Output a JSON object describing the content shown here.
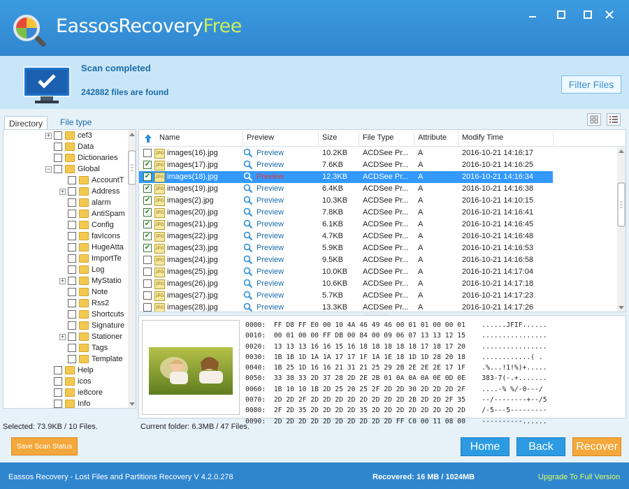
{
  "window": {
    "title_main": "EassosRecovery",
    "title_free": "Free",
    "minimize_icon": "minimize-icon",
    "maximize_icon": "maximize-icon",
    "close_icon": "close-icon"
  },
  "status": {
    "title": "Scan completed",
    "count": "242882 files are found",
    "filter_button": "Filter Files"
  },
  "tabs": [
    "Directory",
    "File type"
  ],
  "tree": [
    {
      "label": "cef3",
      "indent": 1,
      "exp": "+",
      "checked": false
    },
    {
      "label": "Data",
      "indent": 1,
      "exp": "",
      "checked": false
    },
    {
      "label": "Dictionaries",
      "indent": 1,
      "exp": "",
      "checked": false
    },
    {
      "label": "Global",
      "indent": 1,
      "exp": "−",
      "checked": false
    },
    {
      "label": "AccountT",
      "indent": 2,
      "exp": "",
      "checked": false
    },
    {
      "label": "Address",
      "indent": 2,
      "exp": "+",
      "checked": false
    },
    {
      "label": "alarm",
      "indent": 2,
      "exp": "",
      "checked": false
    },
    {
      "label": "AntiSpam",
      "indent": 2,
      "exp": "",
      "checked": false
    },
    {
      "label": "Config",
      "indent": 2,
      "exp": "",
      "checked": false
    },
    {
      "label": "favIcons",
      "indent": 2,
      "exp": "",
      "checked": false
    },
    {
      "label": "HugeAtta",
      "indent": 2,
      "exp": "",
      "checked": false
    },
    {
      "label": "ImportTe",
      "indent": 2,
      "exp": "",
      "checked": false
    },
    {
      "label": "Log",
      "indent": 2,
      "exp": "",
      "checked": false
    },
    {
      "label": "MyStatio",
      "indent": 2,
      "exp": "+",
      "checked": false
    },
    {
      "label": "Note",
      "indent": 2,
      "exp": "",
      "checked": false
    },
    {
      "label": "Rss2",
      "indent": 2,
      "exp": "",
      "checked": false
    },
    {
      "label": "Shortcuts",
      "indent": 2,
      "exp": "",
      "checked": false
    },
    {
      "label": "Signature",
      "indent": 2,
      "exp": "",
      "checked": false
    },
    {
      "label": "Stationer",
      "indent": 2,
      "exp": "+",
      "checked": false
    },
    {
      "label": "Tags",
      "indent": 2,
      "exp": "",
      "checked": false
    },
    {
      "label": "Template",
      "indent": 2,
      "exp": "",
      "checked": false
    },
    {
      "label": "Help",
      "indent": 1,
      "exp": "",
      "checked": false
    },
    {
      "label": "icos",
      "indent": 1,
      "exp": "",
      "checked": false
    },
    {
      "label": "ie8core",
      "indent": 1,
      "exp": "",
      "checked": false
    },
    {
      "label": "Info",
      "indent": 1,
      "exp": "",
      "checked": false
    }
  ],
  "columns": [
    "Name",
    "Preview",
    "Size",
    "File Type",
    "Attribute",
    "Modify Time"
  ],
  "files": [
    {
      "name": "images(16).jpg",
      "preview": "Preview",
      "size": "10.2KB",
      "type": "ACDSee Pr...",
      "attr": "A",
      "time": "2016-10-21 14:16:17",
      "checked": false
    },
    {
      "name": "images(17).jpg",
      "preview": "Preview",
      "size": "7.6KB",
      "type": "ACDSee Pr...",
      "attr": "A",
      "time": "2016-10-21 14:16:25",
      "checked": true
    },
    {
      "name": "images(18).jpg",
      "preview": "Preview",
      "size": "12.3KB",
      "type": "ACDSee Pr...",
      "attr": "A",
      "time": "2016-10-21 14:16:34",
      "checked": true,
      "selected": true
    },
    {
      "name": "images(19).jpg",
      "preview": "Preview",
      "size": "6.4KB",
      "type": "ACDSee Pr...",
      "attr": "A",
      "time": "2016-10-21 14:16:38",
      "checked": true
    },
    {
      "name": "images(2).jpg",
      "preview": "Preview",
      "size": "10.3KB",
      "type": "ACDSee Pr...",
      "attr": "A",
      "time": "2016-10-21 14:10:15",
      "checked": true
    },
    {
      "name": "images(20).jpg",
      "preview": "Preview",
      "size": "7.8KB",
      "type": "ACDSee Pr...",
      "attr": "A",
      "time": "2016-10-21 14:16:41",
      "checked": true
    },
    {
      "name": "images(21).jpg",
      "preview": "Preview",
      "size": "6.1KB",
      "type": "ACDSee Pr...",
      "attr": "A",
      "time": "2016-10-21 14:16:45",
      "checked": true
    },
    {
      "name": "images(22).jpg",
      "preview": "Preview",
      "size": "4.7KB",
      "type": "ACDSee Pr...",
      "attr": "A",
      "time": "2016-10-21 14:16:48",
      "checked": true
    },
    {
      "name": "images(23).jpg",
      "preview": "Preview",
      "size": "5.9KB",
      "type": "ACDSee Pr...",
      "attr": "A",
      "time": "2016-10-21 14:16:53",
      "checked": true
    },
    {
      "name": "images(24).jpg",
      "preview": "Preview",
      "size": "9.5KB",
      "type": "ACDSee Pr...",
      "attr": "A",
      "time": "2016-10-21 14:16:58",
      "checked": false
    },
    {
      "name": "images(25).jpg",
      "preview": "Preview",
      "size": "10.0KB",
      "type": "ACDSee Pr...",
      "attr": "A",
      "time": "2016-10-21 14:17:04",
      "checked": false
    },
    {
      "name": "images(26).jpg",
      "preview": "Preview",
      "size": "10.6KB",
      "type": "ACDSee Pr...",
      "attr": "A",
      "time": "2016-10-21 14:17:18",
      "checked": false
    },
    {
      "name": "images(27).jpg",
      "preview": "Preview",
      "size": "5.7KB",
      "type": "ACDSee Pr...",
      "attr": "A",
      "time": "2016-10-21 14:17:23",
      "checked": false
    },
    {
      "name": "images(28).jpg",
      "preview": "Preview",
      "size": "13.3KB",
      "type": "ACDSee Pr...",
      "attr": "A",
      "time": "2016-10-21 14:17:26",
      "checked": false
    }
  ],
  "hex_lines": [
    "0000:  FF D8 FF E0 00 10 4A 46 49 46 00 01 01 00 00 01    ......JFIF......",
    "0010:  00 01 00 00 FF DB 00 84 00 09 06 07 13 13 12 15    ................",
    "0020:  13 13 13 16 16 15 16 18 18 18 18 18 17 18 17 20    ................",
    "0030:  1B 1B 1D 1A 1A 17 17 1F 1A 1E 18 1D 1D 28 20 18    ............( .",
    "0040:  1B 25 1D 16 16 21 31 21 25 29 2B 2E 2E 2E 17 1F    .%...!1!%)+.....",
    "0050:  33 38 33 2D 37 28 2D 2E 2B 01 0A 0A 0A 0E 0D 0E    383-7(-.+.......",
    "0060:  1B 10 10 1B 2D 25 20 25 2F 2D 2D 30 2D 2D 2D 2F    ....-% %/-0---/",
    "0070:  2D 2D 2F 2D 2D 2D 2D 2D 2D 2D 2D 2B 2D 2D 2F 35    --/--------+--/5",
    "0080:  2F 2D 35 2D 2D 2D 2D 35 2D 2D 2D 2D 2D 2D 2D 2D    /-5---5---------",
    "0090:  2D 2D 2D 2D 2D 2D 2D 2D 2D 2D FF C0 00 11 08 00    ----------......"
  ],
  "selected_info": "Selected: 73.9KB / 10 Files.",
  "folder_info": "Current folder: 6.3MB / 47 Files.",
  "buttons": {
    "save_scan": "Save Scan Status",
    "home": "Home",
    "back": "Back",
    "recover": "Recover"
  },
  "footer": {
    "left": "Eassos Recovery - Lost Files and Partitions Recovery  V 4.2.0.278",
    "mid": "Recovered: 16 MB / 1024MB",
    "upgrade": "Upgrade To Full Version"
  }
}
